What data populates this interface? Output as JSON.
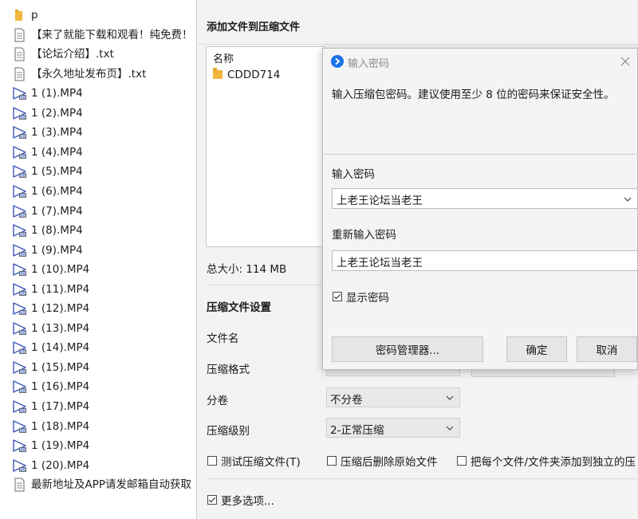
{
  "file_list": [
    {
      "name": "p",
      "icon": "folder-icon"
    },
    {
      "name": "【来了就能下载和观看！纯免费！",
      "icon": "document-icon"
    },
    {
      "name": "【论坛介绍】.txt",
      "icon": "document-icon"
    },
    {
      "name": "【永久地址发布页】.txt",
      "icon": "document-icon"
    },
    {
      "name": "1 (1).MP4",
      "icon": "video-file-icon"
    },
    {
      "name": "1 (2).MP4",
      "icon": "video-file-icon"
    },
    {
      "name": "1 (3).MP4",
      "icon": "video-file-icon"
    },
    {
      "name": "1 (4).MP4",
      "icon": "video-file-icon"
    },
    {
      "name": "1 (5).MP4",
      "icon": "video-file-icon"
    },
    {
      "name": "1 (6).MP4",
      "icon": "video-file-icon"
    },
    {
      "name": "1 (7).MP4",
      "icon": "video-file-icon"
    },
    {
      "name": "1 (8).MP4",
      "icon": "video-file-icon"
    },
    {
      "name": "1 (9).MP4",
      "icon": "video-file-icon"
    },
    {
      "name": "1 (10).MP4",
      "icon": "video-file-icon"
    },
    {
      "name": "1 (11).MP4",
      "icon": "video-file-icon"
    },
    {
      "name": "1 (12).MP4",
      "icon": "video-file-icon"
    },
    {
      "name": "1 (13).MP4",
      "icon": "video-file-icon"
    },
    {
      "name": "1 (14).MP4",
      "icon": "video-file-icon"
    },
    {
      "name": "1 (15).MP4",
      "icon": "video-file-icon"
    },
    {
      "name": "1 (16).MP4",
      "icon": "video-file-icon"
    },
    {
      "name": "1 (17).MP4",
      "icon": "video-file-icon"
    },
    {
      "name": "1 (18).MP4",
      "icon": "video-file-icon"
    },
    {
      "name": "1 (19).MP4",
      "icon": "video-file-icon"
    },
    {
      "name": "1 (20).MP4",
      "icon": "video-file-icon"
    },
    {
      "name": "最新地址及APP请发邮箱自动获取",
      "icon": "document-icon"
    }
  ],
  "compress": {
    "title": "添加文件到压缩文件",
    "file_box": {
      "header": "名称",
      "items": [
        {
          "name": "CDDD714",
          "icon": "folder-icon"
        }
      ]
    },
    "total_size": "总大小: 114 MB",
    "settings_title": "压缩文件设置",
    "labels": {
      "filename": "文件名",
      "format": "压缩格式",
      "split": "分卷",
      "level": "压缩级别"
    },
    "split_value": "不分卷",
    "level_value": "2-正常压缩",
    "checkboxes": {
      "test": {
        "label": "测试压缩文件(T)",
        "checked": false
      },
      "delete": {
        "label": "压缩后删除原始文件",
        "checked": false
      },
      "separate": {
        "label": "把每个文件/文件夹添加到独立的压",
        "checked": false
      }
    },
    "more_options": {
      "label": "更多选项...",
      "checked": true
    }
  },
  "password_dialog": {
    "title": "输入密码",
    "description": "输入压缩包密码。建议使用至少 8 位的密码来保证安全性。",
    "password_label": "输入密码",
    "password_value": "上老王论坛当老王",
    "confirm_label": "重新输入密码",
    "confirm_value": "上老王论坛当老王",
    "show_password": {
      "label": "显示密码",
      "checked": true
    },
    "buttons": {
      "manager": "密码管理器...",
      "ok": "确定",
      "cancel": "取消"
    },
    "accent_color": "#1a73e8"
  }
}
